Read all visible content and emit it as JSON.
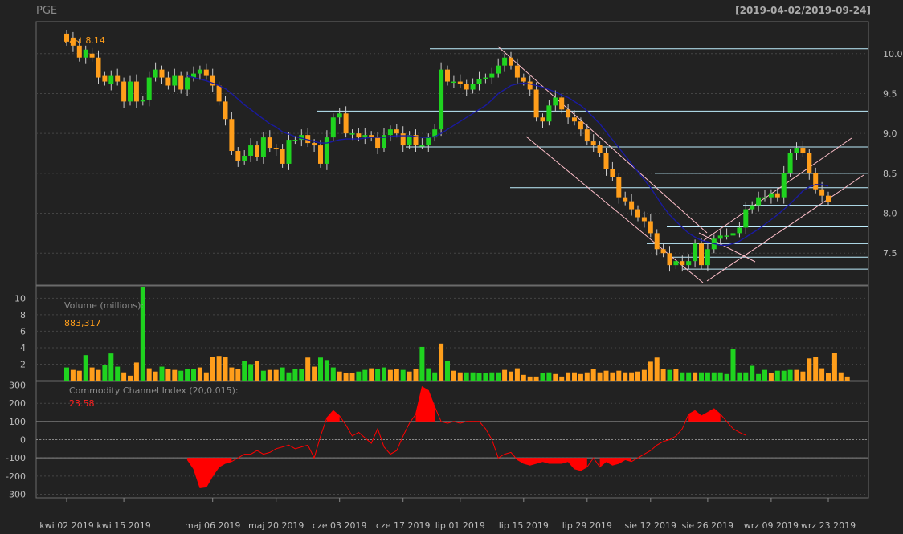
{
  "symbol": "PGE",
  "date_range": "[2019-04-02/2019-09-24]",
  "last_label": "Last 8.14",
  "volume_label": "Volume (millions):",
  "volume_value": "883,317",
  "cci_label": "Commodity Channel Index (20,0.015):",
  "cci_value": "23.58",
  "colors": {
    "background": "#222222",
    "up": "#1fd31f",
    "down": "#ff9e1b",
    "sma": "#1a1aa0",
    "cci": "#ff0000",
    "hlines": "#bfefff",
    "channel": "#ffc0cb",
    "grid": "#444444"
  },
  "chart_data": {
    "type": "candlestick",
    "x_ticks": [
      "kwi 02 2019",
      "kwi 15 2019",
      "maj 06 2019",
      "maj 20 2019",
      "cze 03 2019",
      "cze 17 2019",
      "lip 01 2019",
      "lip 15 2019",
      "lip 29 2019",
      "sie 12 2019",
      "sie 26 2019",
      "wrz 09 2019",
      "wrz 23 2019"
    ],
    "x_tick_index": [
      0,
      9,
      23,
      33,
      43,
      53,
      62,
      72,
      82,
      92,
      101,
      111,
      120
    ],
    "price": {
      "ylim": [
        7.1,
        10.4
      ],
      "y_ticks": [
        7.5,
        8.0,
        8.5,
        9.0,
        9.5,
        10.0
      ],
      "y_tick_labels": [
        "7.5",
        "8.0",
        "8.5",
        "9.0",
        "9.5",
        "10.0"
      ],
      "close": [
        10.15,
        10.1,
        9.95,
        10.05,
        9.95,
        9.7,
        9.65,
        9.72,
        9.65,
        9.4,
        9.65,
        9.4,
        9.42,
        9.7,
        9.8,
        9.7,
        9.6,
        9.72,
        9.55,
        9.7,
        9.75,
        9.8,
        9.72,
        9.6,
        9.4,
        9.18,
        8.78,
        8.66,
        8.72,
        8.85,
        8.7,
        8.95,
        8.82,
        8.8,
        8.62,
        8.92,
        8.92,
        8.98,
        8.88,
        8.85,
        8.62,
        8.95,
        9.2,
        9.25,
        9.0,
        9.0,
        8.95,
        8.98,
        8.95,
        8.82,
        8.98,
        9.05,
        9.0,
        8.85,
        8.98,
        8.85,
        8.85,
        8.95,
        9.05,
        9.8,
        9.65,
        9.65,
        9.62,
        9.55,
        9.62,
        9.68,
        9.7,
        9.75,
        9.85,
        9.95,
        9.85,
        9.7,
        9.65,
        9.55,
        9.2,
        9.15,
        9.35,
        9.45,
        9.3,
        9.2,
        9.15,
        9.05,
        8.9,
        8.85,
        8.75,
        8.55,
        8.45,
        8.2,
        8.15,
        8.05,
        7.95,
        7.9,
        7.75,
        7.55,
        7.5,
        7.35,
        7.4,
        7.35,
        7.4,
        7.62,
        7.35,
        7.55,
        7.68,
        7.72,
        7.72,
        7.75,
        7.82,
        8.05,
        8.1,
        8.2,
        8.2,
        8.25,
        8.2,
        8.5,
        8.75,
        8.82,
        8.75,
        8.5,
        8.3,
        8.22,
        8.14
      ],
      "open": [
        10.25,
        10.2,
        10.1,
        9.95,
        10.0,
        9.95,
        9.72,
        9.62,
        9.72,
        9.65,
        9.4,
        9.65,
        9.4,
        9.42,
        9.7,
        9.8,
        9.7,
        9.6,
        9.72,
        9.55,
        9.7,
        9.75,
        9.8,
        9.72,
        9.6,
        9.4,
        9.18,
        8.78,
        8.66,
        8.72,
        8.85,
        8.7,
        8.95,
        8.82,
        8.8,
        8.62,
        8.92,
        8.92,
        8.98,
        8.88,
        8.85,
        8.62,
        8.95,
        9.2,
        9.25,
        9.0,
        9.0,
        8.95,
        8.98,
        8.95,
        8.82,
        8.98,
        9.05,
        9.0,
        8.85,
        8.98,
        8.85,
        8.85,
        8.95,
        9.05,
        9.8,
        9.65,
        9.65,
        9.62,
        9.55,
        9.62,
        9.68,
        9.7,
        9.75,
        9.85,
        9.95,
        9.85,
        9.7,
        9.65,
        9.55,
        9.2,
        9.15,
        9.35,
        9.45,
        9.3,
        9.2,
        9.15,
        9.05,
        8.9,
        8.85,
        8.75,
        8.55,
        8.45,
        8.2,
        8.15,
        8.05,
        7.95,
        7.9,
        7.75,
        7.55,
        7.5,
        7.35,
        7.4,
        7.35,
        7.4,
        7.62,
        7.35,
        7.55,
        7.68,
        7.72,
        7.72,
        7.75,
        7.82,
        8.05,
        8.1,
        8.2,
        8.2,
        8.25,
        8.2,
        8.5,
        8.75,
        8.82,
        8.75,
        8.5,
        8.3,
        8.22
      ],
      "sma": [
        null,
        null,
        null,
        null,
        null,
        null,
        null,
        null,
        null,
        null,
        null,
        null,
        null,
        null,
        null,
        null,
        null,
        null,
        null,
        9.72,
        9.7,
        9.68,
        9.66,
        9.63,
        9.6,
        9.56,
        9.5,
        9.43,
        9.36,
        9.3,
        9.24,
        9.18,
        9.12,
        9.08,
        9.02,
        8.99,
        8.96,
        8.94,
        8.92,
        8.9,
        8.88,
        8.88,
        8.9,
        8.92,
        8.93,
        8.93,
        8.93,
        8.94,
        8.95,
        8.95,
        8.95,
        8.96,
        8.97,
        8.97,
        8.97,
        8.96,
        8.95,
        8.95,
        8.96,
        9.0,
        9.05,
        9.1,
        9.15,
        9.2,
        9.25,
        9.3,
        9.35,
        9.42,
        9.5,
        9.55,
        9.6,
        9.62,
        9.63,
        9.62,
        9.6,
        9.58,
        9.55,
        9.52,
        9.48,
        9.45,
        9.4,
        9.35,
        9.28,
        9.2,
        9.12,
        9.02,
        8.92,
        8.82,
        8.72,
        8.62,
        8.52,
        8.42,
        8.32,
        8.2,
        8.08,
        7.98,
        7.9,
        7.82,
        7.75,
        7.7,
        7.66,
        7.64,
        7.62,
        7.6,
        7.6,
        7.62,
        7.65,
        7.7,
        7.75,
        7.8,
        7.86,
        7.92,
        7.98,
        8.05,
        8.12,
        8.2,
        8.28,
        8.33,
        8.36,
        8.36,
        8.34
      ]
    },
    "volume": {
      "ylim": [
        0,
        11.5
      ],
      "y_ticks": [
        2,
        4,
        6,
        8,
        10
      ],
      "y_tick_labels": [
        "2",
        "4",
        "6",
        "8",
        "10"
      ],
      "values": [
        1.6,
        1.3,
        1.2,
        3.1,
        1.6,
        1.3,
        1.9,
        3.3,
        1.7,
        1.0,
        0.6,
        2.2,
        11.4,
        1.5,
        1.1,
        1.7,
        1.4,
        1.3,
        1.2,
        1.4,
        1.4,
        1.6,
        1.0,
        2.9,
        3.0,
        2.9,
        1.6,
        1.4,
        2.4,
        2.0,
        2.4,
        1.2,
        1.3,
        1.3,
        1.6,
        1.0,
        1.4,
        1.4,
        2.8,
        1.7,
        2.8,
        2.5,
        1.6,
        1.1,
        0.9,
        0.9,
        1.1,
        1.3,
        1.5,
        1.4,
        1.6,
        1.3,
        1.4,
        1.3,
        1.1,
        1.4,
        4.1,
        1.5,
        1.0,
        4.5,
        2.4,
        1.2,
        1.0,
        1.0,
        1.0,
        0.9,
        0.9,
        1.0,
        1.0,
        1.3,
        1.1,
        1.5,
        0.7,
        0.5,
        0.5,
        0.9,
        1.0,
        0.8,
        0.5,
        1.0,
        1.0,
        0.8,
        1.0,
        1.4,
        1.0,
        1.2,
        1.0,
        1.2,
        1.0,
        1.0,
        1.1,
        1.3,
        2.3,
        2.8,
        1.4,
        1.3,
        1.4,
        1.0,
        1.0,
        1.0,
        1.0,
        1.0,
        1.0,
        1.0,
        0.8,
        3.8,
        1.0,
        1.0,
        1.8,
        0.8,
        1.3,
        0.9,
        1.2,
        1.2,
        1.3,
        1.3,
        1.1,
        2.7,
        2.9,
        1.5,
        0.9,
        3.4,
        1.0,
        0.5
      ],
      "up": [
        true,
        false,
        false,
        true,
        false,
        false,
        true,
        true,
        true,
        false,
        false,
        false,
        true,
        false,
        false,
        true,
        false,
        false,
        true,
        true,
        true,
        false,
        false,
        false,
        false,
        false,
        false,
        false,
        true,
        true,
        false,
        true,
        false,
        false,
        true,
        true,
        true,
        true,
        false,
        false,
        true,
        true,
        true,
        false,
        false,
        false,
        true,
        true,
        false,
        true,
        true,
        false,
        false,
        true,
        false,
        false,
        true,
        true,
        true,
        false,
        true,
        false,
        false,
        true,
        true,
        true,
        true,
        true,
        true,
        false,
        false,
        false,
        false,
        false,
        false,
        true,
        true,
        false,
        false,
        false,
        false,
        false,
        false,
        false,
        false,
        false,
        false,
        false,
        false,
        false,
        false,
        false,
        false,
        false,
        false,
        true,
        false,
        true,
        true,
        false,
        true,
        true,
        true,
        true,
        true,
        true,
        true,
        true,
        true,
        true,
        true,
        false,
        true,
        true,
        true,
        false,
        false,
        false,
        false,
        false,
        false
      ],
      "last": 883317
    },
    "cci": {
      "ylim": [
        -320,
        320
      ],
      "y_ticks": [
        -300,
        -200,
        -100,
        0,
        100,
        200,
        300
      ],
      "y_tick_labels": [
        "-300",
        "-200",
        "-100",
        "0",
        "100",
        "200",
        "300"
      ],
      "values": [
        null,
        null,
        null,
        null,
        null,
        null,
        null,
        null,
        null,
        null,
        null,
        null,
        null,
        null,
        null,
        null,
        null,
        null,
        null,
        -110,
        -160,
        -265,
        -260,
        -200,
        -150,
        -130,
        -120,
        -100,
        -80,
        -80,
        -60,
        -80,
        -70,
        -50,
        -40,
        -30,
        -50,
        -40,
        -30,
        -100,
        20,
        120,
        160,
        130,
        80,
        20,
        40,
        10,
        -20,
        60,
        -40,
        -80,
        -60,
        20,
        90,
        140,
        290,
        270,
        180,
        100,
        90,
        100,
        90,
        100,
        100,
        100,
        60,
        0,
        -100,
        -80,
        -70,
        -110,
        -130,
        -140,
        -130,
        -120,
        -130,
        -130,
        -130,
        -120,
        -160,
        -170,
        -150,
        -100,
        -150,
        -120,
        -140,
        -130,
        -110,
        -120,
        -100,
        -80,
        -60,
        -30,
        -10,
        0,
        20,
        60,
        140,
        160,
        130,
        150,
        170,
        140,
        100,
        60,
        40,
        24
      ],
      "last": 23.58
    }
  }
}
